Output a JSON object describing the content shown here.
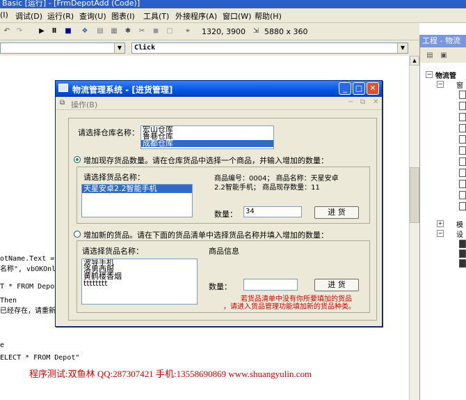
{
  "ide": {
    "title": "Basic [运行] - [FrmDepotAdd (Code)]",
    "menu": [
      "(I)",
      "调试(D)",
      "运行(R)",
      "查询(U)",
      "图表(I)",
      "工具(T)",
      "外接程序(A)",
      "窗口(W)",
      "帮助(H)"
    ],
    "toolbar": {
      "position": "1320, 3900",
      "size": "5880 x 360"
    },
    "object_combo": "",
    "proc_combo": "Click",
    "code_lines": [
      "otName.Text = \"",
      "名称\", vbOKOnly",
      "T * FROM Depot",
      "Then",
      "已经存在，请重新",
      "e",
      "ELECT * FROM Depot\""
    ],
    "credit": "程序测试:双鱼林 QQ:287307421 手机:13558690869 www.shuangyulin.com"
  },
  "project": {
    "title": "工程 - 物流",
    "tree": [
      "物流管",
      "窗",
      "模",
      "设"
    ]
  },
  "dialog": {
    "title": "物流管理系统 - [进货管理]",
    "menu_label": "操作(B)",
    "warehouse_label": "请选择仓库名称：",
    "warehouses": [
      "宏山仓库",
      "鲁巷仓库",
      "成都仓库"
    ],
    "warehouse_selected": 2,
    "opt_existing": "增加现存货品数量。请在仓库货品中选择一个商品，并输入增加的数量：",
    "existing_goods_label": "请选择货品名称：",
    "existing_goods": [
      "天星安卓2.2智能手机"
    ],
    "goods_info_line1": "商品编号：0004；      商品名称：天星安卓",
    "goods_info_line2": "2.2智能手机；       商品现存数量：11",
    "qty_label": "数量：",
    "qty_value": "34",
    "stock_button": "进 货",
    "opt_new": "增加新的货品。请在下面的货品清单中选择货品名称并填入增加的数量：",
    "new_goods_label": "请选择货品名称：",
    "new_goods": [
      "波导手机",
      "洛男西服",
      "黄鹤楼香烟",
      "tttttttt"
    ],
    "goods_info_title": "商品信息",
    "qty_label_new": "数量：",
    "qty_value_new": "",
    "stock_button_new": "进 货",
    "warning_line1": "若货品清单中没有你所要填加的货品",
    "warning_line2": "，请进入货品管理功能填加新的货品种类。"
  },
  "colors": {
    "selection": "#316ac5",
    "warning": "#d40000",
    "titlebar": "#0054e3"
  }
}
